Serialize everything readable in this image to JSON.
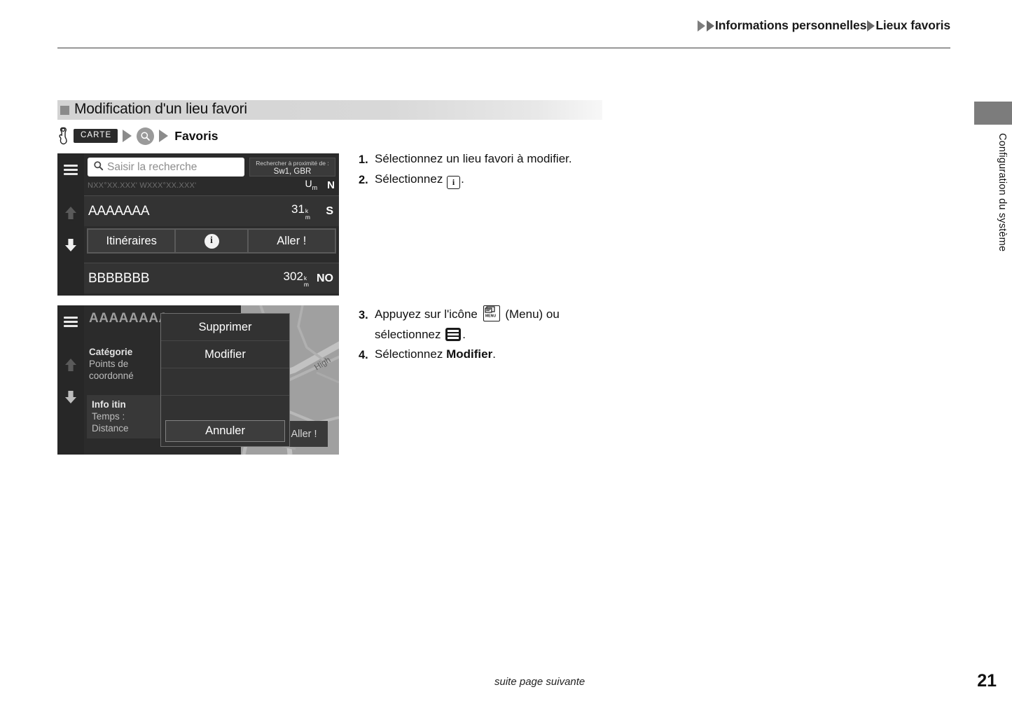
{
  "header": {
    "breadcrumb": [
      "Informations personnelles",
      "Lieux favoris"
    ],
    "arrow_icon": "triangle-right-icon"
  },
  "section": {
    "title": "Modification d'un lieu favori",
    "bullet_icon": "square-bullet-icon"
  },
  "path": {
    "hand_icon": "hand-pointer-icon",
    "chip_label": "CARTE",
    "search_icon": "magnifier-icon",
    "arrow_icon": "triangle-right-icon",
    "destination": "Favoris"
  },
  "device_one": {
    "sidebar": {
      "menu_icon": "hamburger-menu-icon",
      "scroll_up_icon": "arrow-up-icon",
      "scroll_down_icon": "arrow-down-icon"
    },
    "search": {
      "icon": "magnifier-icon",
      "placeholder": "Saisir la recherche"
    },
    "near_box": {
      "line1": "Rechercher à proximité de :",
      "line2": "Sw1, GBR"
    },
    "units": {
      "distance_unit": "U",
      "distance_unit_sub": "m",
      "direction": "N"
    },
    "coordinates": "NXX°XX.XXX' WXXX°XX.XXX'",
    "rows": [
      {
        "name": "AAAAAAA",
        "distance": "31",
        "unit_top": "k",
        "unit_bottom": "m",
        "direction": "S"
      },
      {
        "name": "BBBBBBB",
        "distance": "302",
        "unit_top": "k",
        "unit_bottom": "m",
        "direction": "NO"
      }
    ],
    "actions": {
      "routes_label": "Itinéraires",
      "info_icon": "info-circle-icon",
      "info_label": "i",
      "go_label": "Aller !"
    }
  },
  "device_two": {
    "sidebar": {
      "menu_icon": "hamburger-menu-icon",
      "scroll_up_icon": "arrow-up-icon",
      "scroll_down_icon": "arrow-down-icon"
    },
    "detail": {
      "title": "AAAAAAAA",
      "category_label": "Catégorie",
      "category_line1": "Points de",
      "category_line2": "coordonné",
      "route_info_label": "Info itin",
      "time_label": "Temps :",
      "distance_label": "Distance"
    },
    "map": {
      "road_label": "High",
      "pin_icon": "heart-favorite-pin-icon",
      "go_label": "Aller !"
    },
    "dialog": {
      "items": [
        "Supprimer",
        "Modifier"
      ],
      "cancel_label": "Annuler"
    }
  },
  "steps_a": [
    {
      "num": "1.",
      "before": "Sélectionnez un lieu favori à modifier.",
      "icon": null,
      "after": ""
    },
    {
      "num": "2.",
      "before": "Sélectionnez ",
      "icon": "info-square-icon",
      "icon_label": "i",
      "after": "."
    }
  ],
  "steps_b": {
    "step3_num": "3.",
    "step3_part1": "Appuyez sur l'icône ",
    "step3_menu_icon": "menu-hardware-icon",
    "step3_menu_icon_label": "MENU",
    "step3_part2": " (Menu) ou",
    "step3_part3": "sélectionnez ",
    "step3_ham_icon": "hamburger-menu-icon",
    "step3_part4": ".",
    "step4_num": "4.",
    "step4_part1": "Sélectionnez ",
    "step4_bold": "Modifier",
    "step4_part2": "."
  },
  "side_tab": {
    "label": "Configuration du système"
  },
  "footer": {
    "note": "suite page suivante",
    "page_number": "21"
  }
}
